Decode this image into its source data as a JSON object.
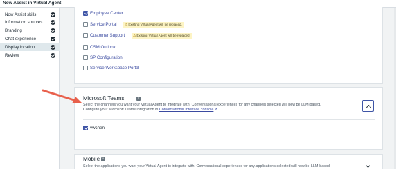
{
  "app_title": "Now Assist in Virtual Agent",
  "sidebar": {
    "items": [
      {
        "label": "Now Assist skills",
        "completed": true,
        "active": false
      },
      {
        "label": "Information sources",
        "completed": true,
        "active": false
      },
      {
        "label": "Branding",
        "completed": true,
        "active": false
      },
      {
        "label": "Chat experience",
        "completed": true,
        "active": false
      },
      {
        "label": "Display location",
        "completed": true,
        "active": true
      },
      {
        "label": "Review",
        "completed": true,
        "active": false
      }
    ]
  },
  "portals": {
    "options": [
      {
        "label": "Employee Center",
        "checked": true,
        "warning": ""
      },
      {
        "label": "Service Portal",
        "checked": false,
        "warning": "Existing Virtual Agent will be replaced."
      },
      {
        "label": "Customer Support",
        "checked": false,
        "warning": "Existing Virtual Agent will be replaced."
      },
      {
        "label": "CSM Outlook",
        "checked": false,
        "warning": ""
      },
      {
        "label": "SP Configuration",
        "checked": false,
        "warning": ""
      },
      {
        "label": "Service Workspace Portal",
        "checked": false,
        "warning": ""
      }
    ]
  },
  "teams": {
    "title": "Microsoft Teams",
    "desc_line1": "Select the channels you want your Virtual Agent to integrate with. Conversational experiences for any channels selected will now be LLM-based.",
    "desc_line2_prefix": "Configure your Microsoft Teams integration in ",
    "desc_link": "Conversational Interface console",
    "options": [
      {
        "label": "vwchen",
        "checked": true
      }
    ]
  },
  "mobile": {
    "title": "Mobile",
    "desc_line1": "Select the applications you want your Virtual Agent to integrate with. Conversational experiences for any applications selected will now be LLM-based."
  },
  "colors": {
    "accent": "#3f55a6",
    "annotation_arrow": "#e8604c",
    "warning_bg": "#fdf4c4"
  },
  "icons": {
    "warning": "warning-triangle-icon",
    "info": "info-icon",
    "external_link": "external-link-icon",
    "check": "check-circle-icon"
  }
}
